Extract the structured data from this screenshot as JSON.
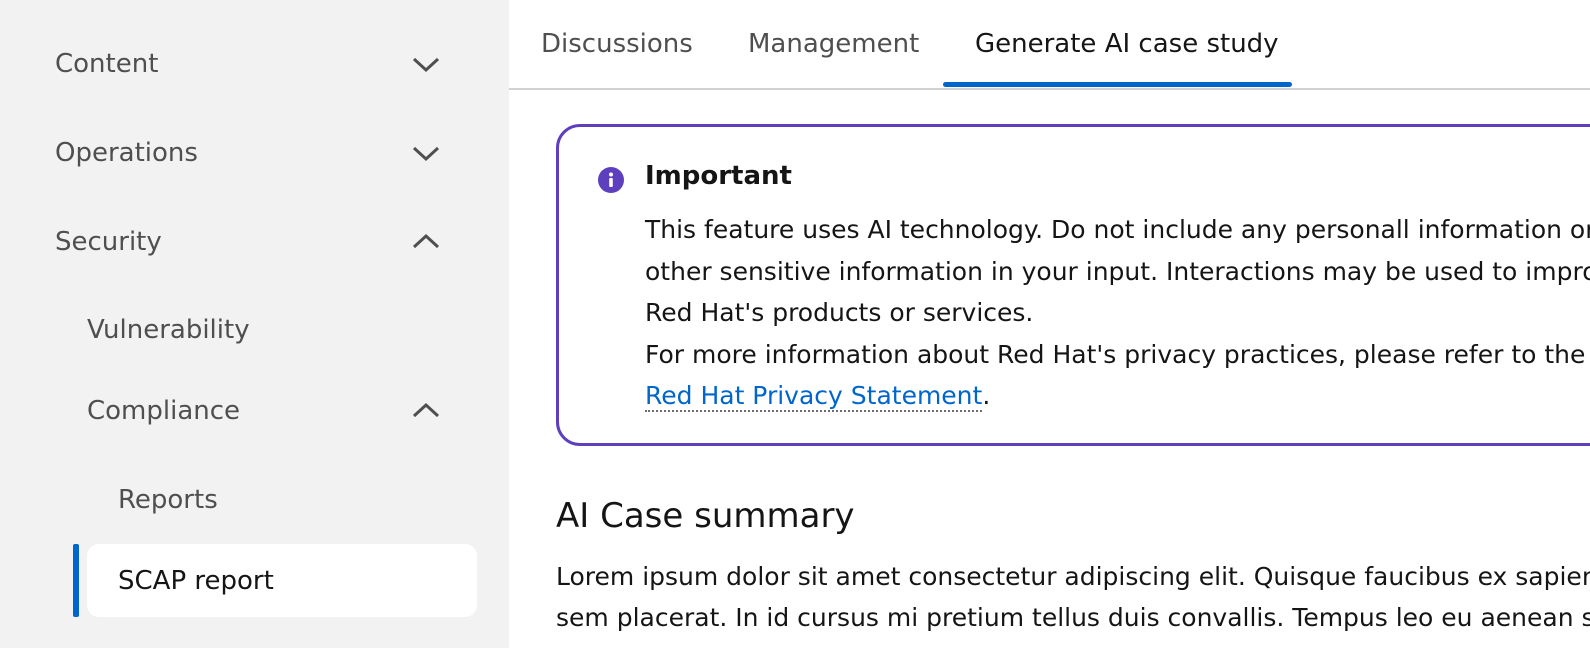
{
  "sidebar": {
    "items": [
      {
        "label": "Content",
        "expanded": false
      },
      {
        "label": "Operations",
        "expanded": false
      },
      {
        "label": "Security",
        "expanded": true
      },
      {
        "label": "Vulnerability"
      },
      {
        "label": "Compliance",
        "expanded": true
      },
      {
        "label": "Reports"
      },
      {
        "label": "SCAP report",
        "current": true
      }
    ]
  },
  "tabs": [
    {
      "label": "Discussions"
    },
    {
      "label": "Management"
    },
    {
      "label": "Generate AI case study",
      "active": true
    }
  ],
  "alert": {
    "title": "Important",
    "line1": "This feature uses AI technology. Do not include any personall information or",
    "line2": "other sensitive information in your input. Interactions may be used to improve",
    "line3": "Red Hat's products or services.",
    "line4": "For more information about Red Hat's privacy practices, please refer to the",
    "link_text": "Red Hat Privacy Statement",
    "link_suffix": ".",
    "icon": "info-circle-icon"
  },
  "summary": {
    "title": "AI Case summary",
    "line1": "Lorem ipsum dolor sit amet consectetur adipiscing elit. Quisque faucibus ex sapien vitae",
    "line2": "sem placerat. In id cursus mi pretium tellus duis convallis. Tempus leo eu aenean sed diam"
  },
  "colors": {
    "accent": "#0066cc",
    "alert_border": "#5e40be",
    "sidebar_bg": "#f2f2f2"
  }
}
